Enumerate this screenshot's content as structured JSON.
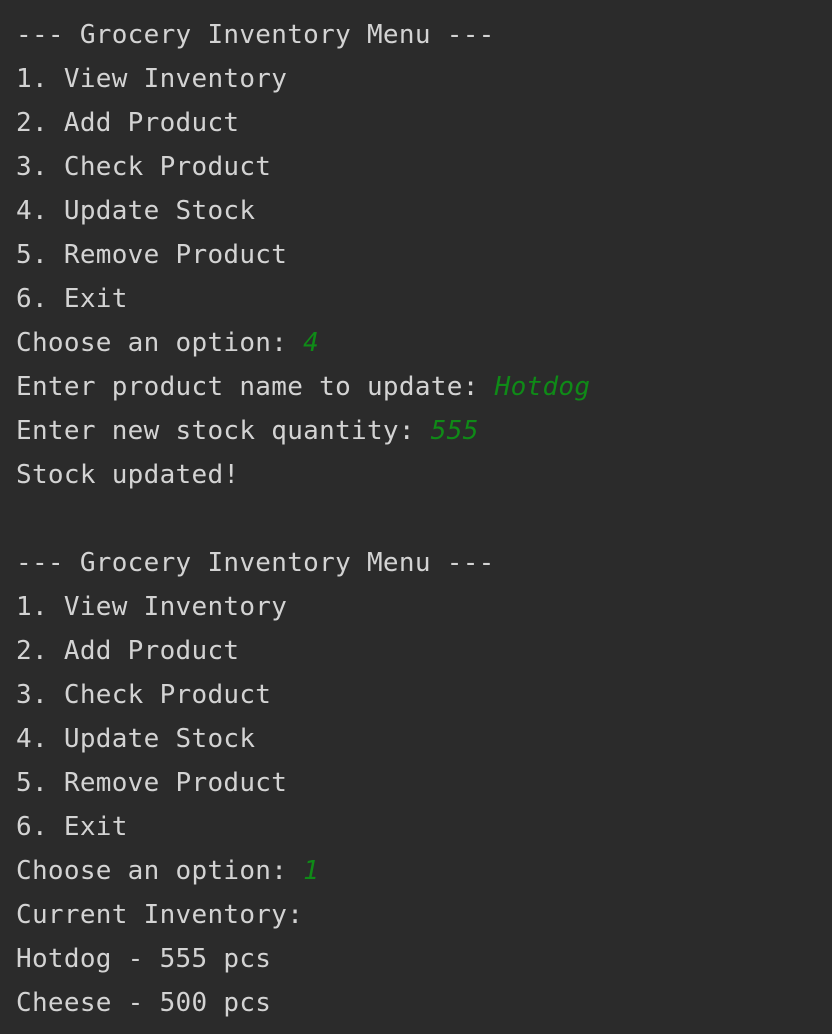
{
  "session1": {
    "menu_header": "--- Grocery Inventory Menu ---",
    "options": [
      "1. View Inventory",
      "2. Add Product",
      "3. Check Product",
      "4. Update Stock",
      "5. Remove Product",
      "6. Exit"
    ],
    "choose_prompt": "Choose an option: ",
    "choose_input": "4",
    "name_prompt": "Enter product name to update: ",
    "name_input": "Hotdog",
    "qty_prompt": "Enter new stock quantity: ",
    "qty_input": "555",
    "result": "Stock updated!"
  },
  "session2": {
    "menu_header": "--- Grocery Inventory Menu ---",
    "options": [
      "1. View Inventory",
      "2. Add Product",
      "3. Check Product",
      "4. Update Stock",
      "5. Remove Product",
      "6. Exit"
    ],
    "choose_prompt": "Choose an option: ",
    "choose_input": "1",
    "inventory_header": "Current Inventory:",
    "inventory_items": [
      "Hotdog - 555 pcs",
      "Cheese - 500 pcs"
    ]
  },
  "colors": {
    "background": "#2b2b2b",
    "output_text": "#d3d3d3",
    "user_input": "#0f8a17"
  }
}
